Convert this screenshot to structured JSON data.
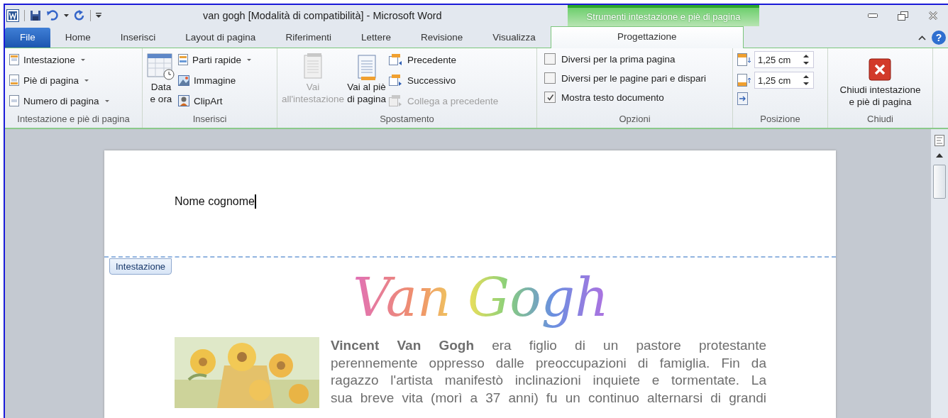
{
  "window": {
    "title": "van gogh [Modalità di compatibilità]  -  Microsoft Word",
    "context_group": "Strumenti intestazione e piè di pagina",
    "help": "?"
  },
  "tabs": [
    {
      "label": "File",
      "selected": false,
      "kind": "file"
    },
    {
      "label": "Home",
      "selected": false,
      "kind": "normal"
    },
    {
      "label": "Inserisci",
      "selected": false,
      "kind": "normal"
    },
    {
      "label": "Layout di pagina",
      "selected": false,
      "kind": "normal"
    },
    {
      "label": "Riferimenti",
      "selected": false,
      "kind": "normal"
    },
    {
      "label": "Lettere",
      "selected": false,
      "kind": "normal"
    },
    {
      "label": "Revisione",
      "selected": false,
      "kind": "normal"
    },
    {
      "label": "Visualizza",
      "selected": false,
      "kind": "normal"
    },
    {
      "label": "Progettazione",
      "selected": true,
      "kind": "context"
    }
  ],
  "ribbon": {
    "groups": [
      {
        "label": "Intestazione e piè di pagina",
        "items": [
          {
            "label": "Intestazione"
          },
          {
            "label": "Piè di pagina"
          },
          {
            "label": "Numero di pagina"
          }
        ]
      },
      {
        "label": "Inserisci",
        "items": [
          {
            "label": "Data\ne ora"
          },
          {
            "label": "Parti rapide"
          },
          {
            "label": "Immagine"
          },
          {
            "label": "ClipArt"
          }
        ]
      },
      {
        "label": "Spostamento",
        "items": [
          {
            "label": "Vai\nall'intestazione",
            "disabled": true
          },
          {
            "label": "Vai al piè\ndi pagina",
            "disabled": false
          },
          {
            "label": "Precedente",
            "disabled": false
          },
          {
            "label": "Successivo",
            "disabled": false
          },
          {
            "label": "Collega a precedente",
            "disabled": true
          }
        ]
      },
      {
        "label": "Opzioni",
        "items": [
          {
            "label": "Diversi per la prima pagina",
            "checked": false
          },
          {
            "label": "Diversi per le pagine pari e dispari",
            "checked": false
          },
          {
            "label": "Mostra testo documento",
            "checked": true
          }
        ]
      },
      {
        "label": "Posizione",
        "items": [
          {
            "value": "1,25 cm"
          },
          {
            "value": "1,25 cm"
          }
        ]
      },
      {
        "label": "Chiudi",
        "items": [
          {
            "label": "Chiudi intestazione\ne piè di pagina"
          }
        ]
      }
    ]
  },
  "document": {
    "header_text": "Nome cognome",
    "header_tag": "Intestazione",
    "wordart": "Van Gogh",
    "paragraph": "**Vincent Van Gogh** era figlio di un pastore protestante\nperennemente oppresso dalle preoccupazioni di famiglia. Fin da\nragazzo l'artista manifestò inclinazioni inquiete e tormentate. La\nsua breve vita (morì a 37 anni) fu un continuo alternarsi di grandi"
  }
}
